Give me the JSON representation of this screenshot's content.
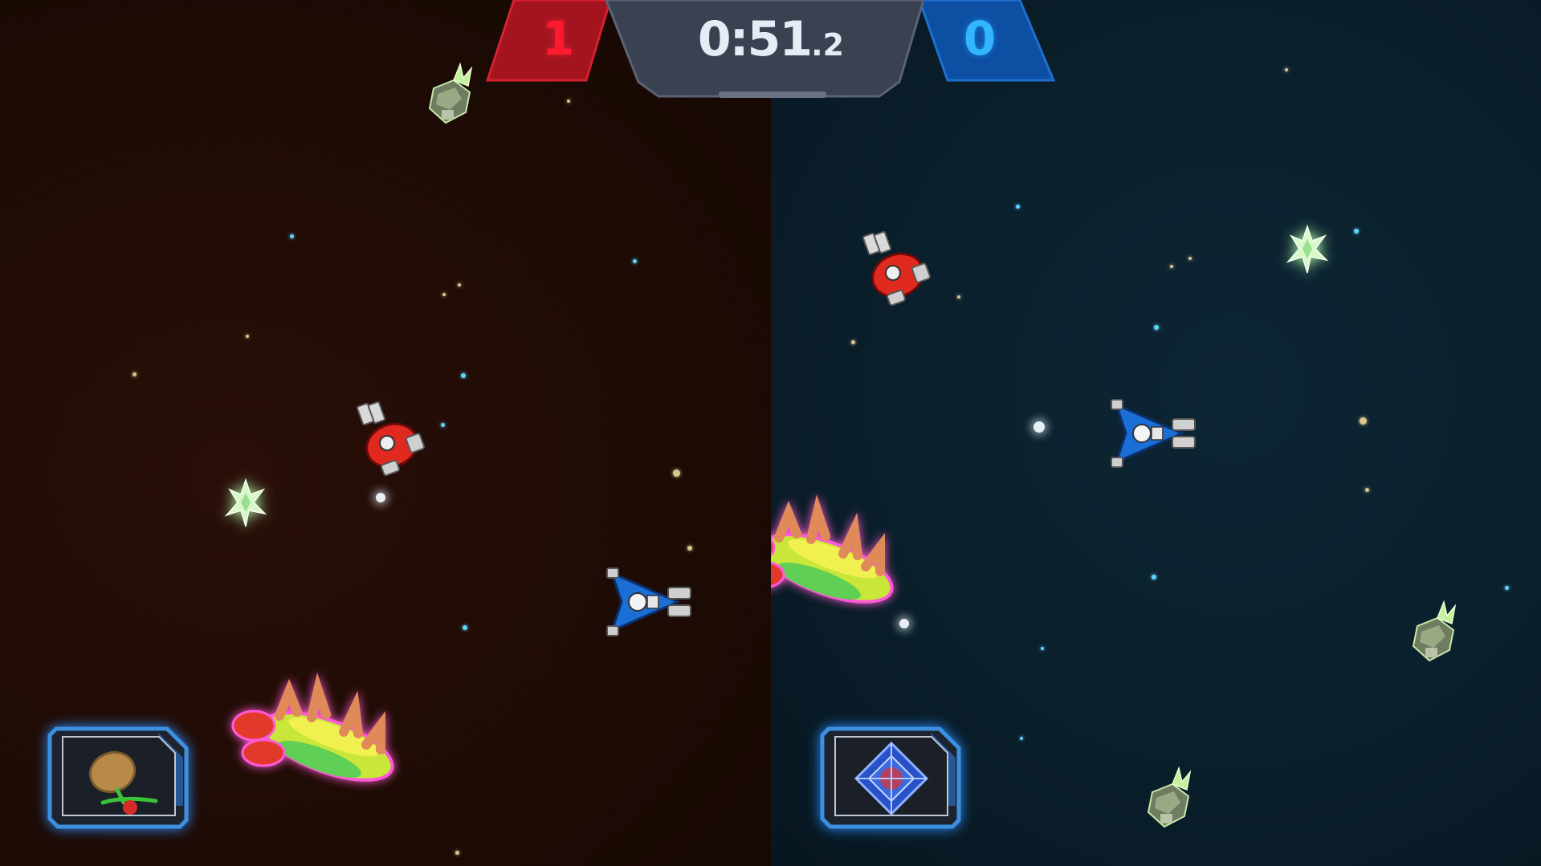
{
  "hud": {
    "red_score": "1",
    "blue_score": "0",
    "timer_main": "0:51",
    "timer_fraction": ".2"
  },
  "abilities": {
    "left_icon": "fruit-bomb-icon",
    "right_icon": "shield-crystal-icon"
  },
  "colors": {
    "red_team": "#e01a2c",
    "blue_team": "#1672d8",
    "left_bg": "#1e0b05",
    "right_bg": "#0a1f2b",
    "hud_panel": "#3a4150"
  }
}
